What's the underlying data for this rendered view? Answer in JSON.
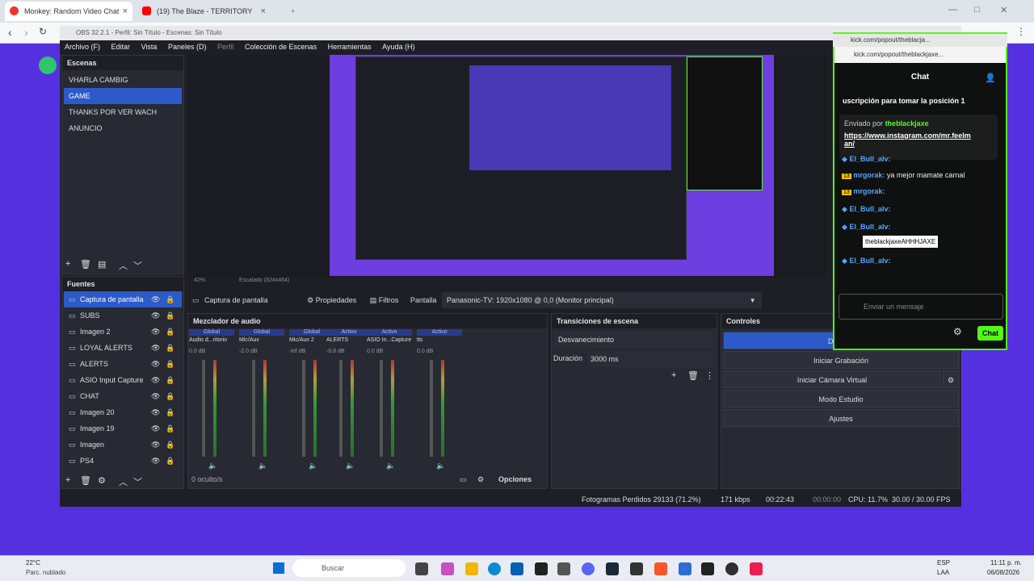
{
  "browser": {
    "tabs": [
      {
        "title": "Monkey: Random Video Chat"
      },
      {
        "title": "(19) The Blaze - TERRITORY (Off..."
      }
    ]
  },
  "obs": {
    "title": "OBS 32.2.1 - Perfil: Sin Título - Escenas: Sin Título",
    "menu": [
      "Archivo (F)",
      "Editar",
      "Vista",
      "Paneles (D)",
      "Perfil",
      "Colección de Escenas",
      "Herramientas",
      "Ayuda (H)"
    ],
    "scenes_title": "Escenas",
    "scenes": [
      "VHARLA CAMBIG",
      "GAME",
      "THANKS POR VER WACH",
      "ANUNCIO"
    ],
    "sources_title": "Fuentes",
    "sources": [
      "Captura de pantalla",
      "SUBS",
      "Imagen 2",
      "LOYAL ALERTS",
      "ALERTS",
      "ASIO Input Capture",
      "CHAT",
      "Imagen 20",
      "Imagen 19",
      "Imagen",
      "PS4"
    ],
    "zoom": "42%",
    "scale": "Escalado (824x464)",
    "source_bar": {
      "selected": "Captura de pantalla",
      "props": "Propiedades",
      "filters": "Filtros",
      "screen_label": "Pantalla",
      "screen_value": "Panasonic-TV: 1920x1080 @ 0,0 (Monitor principal)"
    },
    "mixer": {
      "title": "Mezclador de audio",
      "tags": [
        "Global",
        "Global",
        "Global",
        "Activo",
        "Activo",
        "Activo"
      ],
      "channels": [
        "Audio d...ritorio",
        "Mic/Aux",
        "Mic/Aux 2",
        "ALERTS",
        "ASIO In...Capture",
        "tts"
      ],
      "db": [
        "0.0 dB",
        "-2.0 dB",
        "-inf dB",
        "-0.8 dB",
        "0.0 dB",
        "0.0 dB"
      ],
      "hidden": "0 oculto/s",
      "options": "Opciones",
      "scale": [
        "0",
        "-6",
        "-12",
        "-18",
        "-24",
        "-30",
        "-36",
        "-42",
        "-48",
        "-54",
        "-60"
      ]
    },
    "transitions": {
      "title": "Transiciones de escena",
      "value": "Desvanecimiento",
      "duration_label": "Duración",
      "duration_value": "3000 ms"
    },
    "controls": {
      "title": "Controles",
      "buttons": [
        "Detener",
        "Iniciar Grabación",
        "Iniciar Cámara Virtual",
        "Modo Estudio",
        "Ajustes"
      ]
    },
    "status": {
      "dropped": "Fotogramas Perdidos 29133 (71.2%)",
      "kbps": "171 kbps",
      "live": "00:22:43",
      "rec": "00:00:00",
      "cpu": "CPU: 11.7%",
      "fps": "30.00 / 30.00 FPS"
    }
  },
  "kick": {
    "tab": "kick.com/popout/theblacja...",
    "url": "kick.com/popout/theblackjaxe...",
    "header": "Chat",
    "sub": "uscripción para tomar la posición 1",
    "pinned_by": "Enviado por",
    "pinned_user": "theblackjaxe",
    "pinned_link": "https://www.instagram.com/mr.feelman/",
    "messages": [
      {
        "badge": "",
        "user": "El_Bull_alv:",
        "text": ""
      },
      {
        "badge": "13",
        "user": "mrgorak:",
        "text": "ya mejor mamate carnal"
      },
      {
        "badge": "13",
        "user": "mrgorak:",
        "text": ""
      },
      {
        "badge": "",
        "user": "El_Bull_alv:",
        "text": ""
      },
      {
        "badge": "",
        "user": "El_Bull_alv:",
        "text": ""
      },
      {
        "badge": "",
        "user": "El_Bull_alv:",
        "text": ""
      }
    ],
    "tooltip": "theblackjaxeAHHHJAXE",
    "input_placeholder": "Enviar un mensaje",
    "send": "Chat"
  },
  "taskbar": {
    "weather": "22°C",
    "weather2": "Parc. nublado",
    "search": "Buscar",
    "lang": "ESP",
    "lang2": "LAA",
    "time": "11:11 p. m.",
    "date": "06/08/2026"
  }
}
